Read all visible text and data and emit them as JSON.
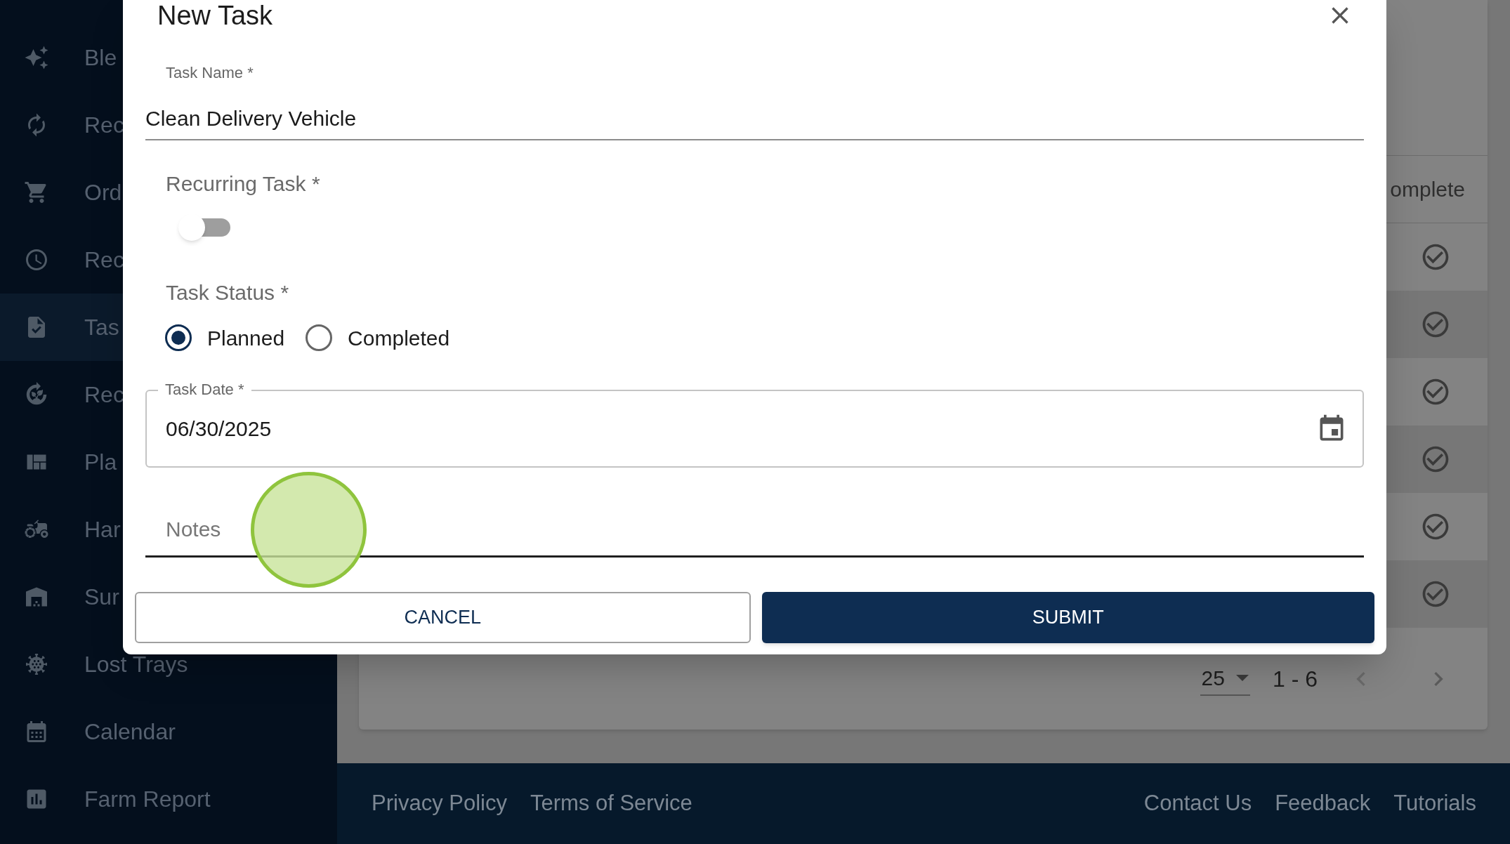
{
  "sidebar": {
    "items": [
      {
        "label": "Ble",
        "selected": false
      },
      {
        "label": "Rec",
        "selected": false
      },
      {
        "label": "Ord",
        "selected": false
      },
      {
        "label": "Rec",
        "selected": false
      },
      {
        "label": "Tas",
        "selected": true
      },
      {
        "label": "Rec",
        "selected": false
      },
      {
        "label": "Pla",
        "selected": false
      },
      {
        "label": "Har",
        "selected": false
      },
      {
        "label": "Sur",
        "selected": false
      },
      {
        "label": "Lost Trays",
        "selected": false
      },
      {
        "label": "Calendar",
        "selected": false
      },
      {
        "label": "Farm Report",
        "selected": false
      }
    ]
  },
  "table": {
    "column_header": "omplete",
    "rows": [
      {
        "completed": true
      },
      {
        "completed": true
      },
      {
        "completed": true
      },
      {
        "completed": true
      },
      {
        "completed": true
      },
      {
        "completed": true
      }
    ],
    "pagination": {
      "rows_per_page": "25",
      "range": "1 - 6",
      "prev_disabled": true,
      "next_disabled": false
    }
  },
  "dialog": {
    "title": "New Task",
    "task_name": {
      "label": "Task Name",
      "required_mark": "*",
      "value": "Clean Delivery Vehicle"
    },
    "recurring": {
      "label": "Recurring Task",
      "required_mark": "*",
      "on": false
    },
    "status": {
      "label": "Task Status",
      "required_mark": "*",
      "options": [
        {
          "label": "Planned",
          "selected": true
        },
        {
          "label": "Completed",
          "selected": false
        }
      ]
    },
    "task_date": {
      "label": "Task Date *",
      "value": "06/30/2025"
    },
    "notes": {
      "placeholder": "Notes"
    },
    "buttons": [
      {
        "label": "CANCEL",
        "kind": "secondary"
      },
      {
        "label": "SUBMIT",
        "kind": "primary"
      }
    ]
  },
  "footer": {
    "left_links": [
      "Privacy Policy",
      "Terms of Service"
    ],
    "right_links": [
      "Contact Us",
      "Feedback",
      "Tutorials"
    ]
  }
}
